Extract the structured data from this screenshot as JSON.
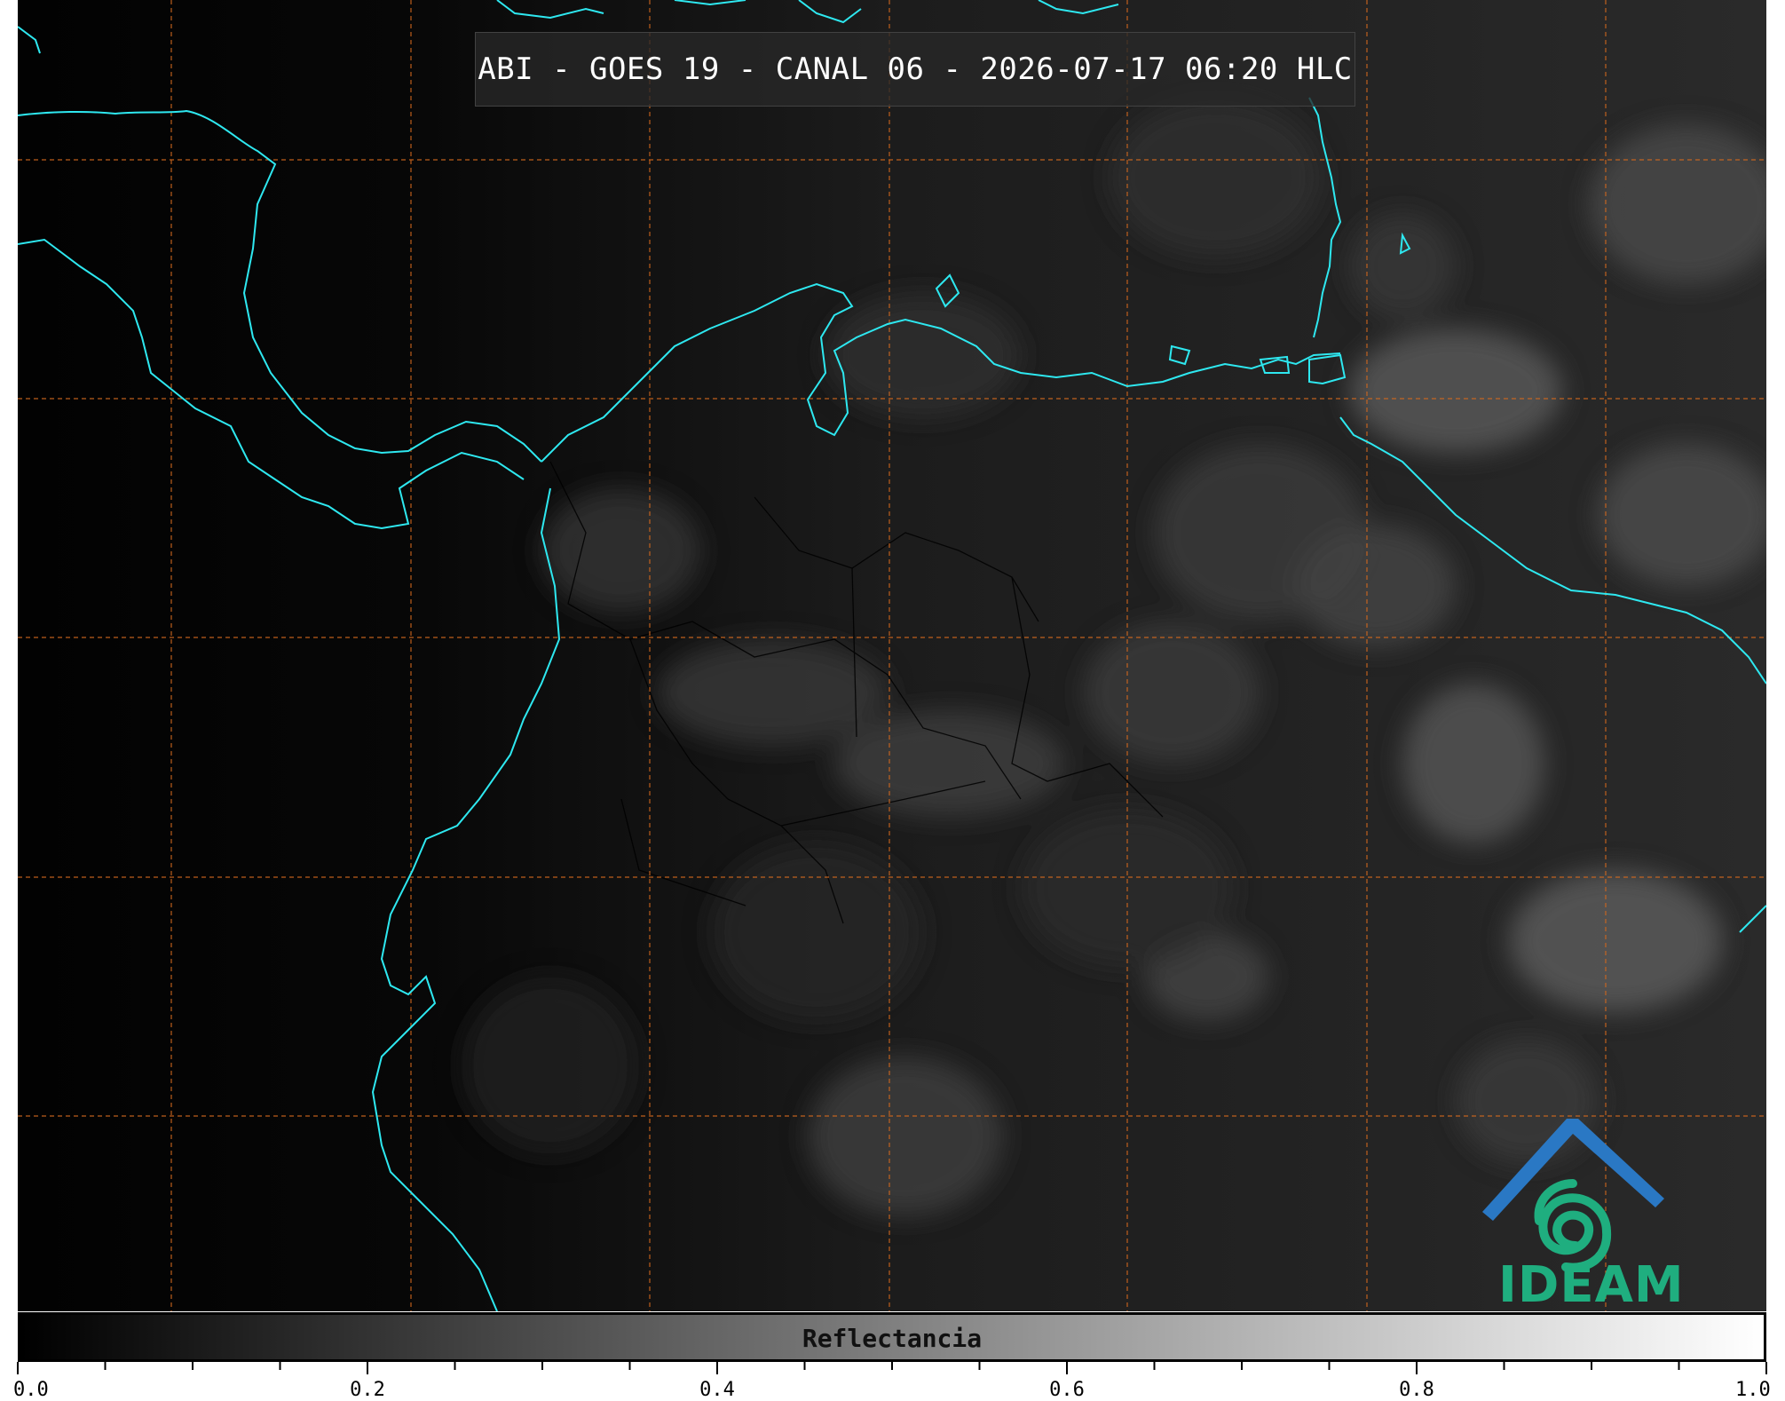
{
  "title": "ABI - GOES 19 - CANAL 06 - 2026-07-17 06:20 HLC",
  "colorbar": {
    "label": "Reflectancia",
    "min": 0.0,
    "max": 1.0,
    "tick_labels": [
      "0.0",
      "0.2",
      "0.4",
      "0.6",
      "0.8",
      "1.0"
    ],
    "gradient_start": "#000000",
    "gradient_end": "#ffffff"
  },
  "logo": {
    "text": "IDEAM",
    "roof_color": "#2a78c4",
    "swirl_color": "#1fae7f"
  },
  "colors": {
    "coastline": "#2ee8f0",
    "graticule": "#d2691e",
    "borders": "#000000"
  }
}
